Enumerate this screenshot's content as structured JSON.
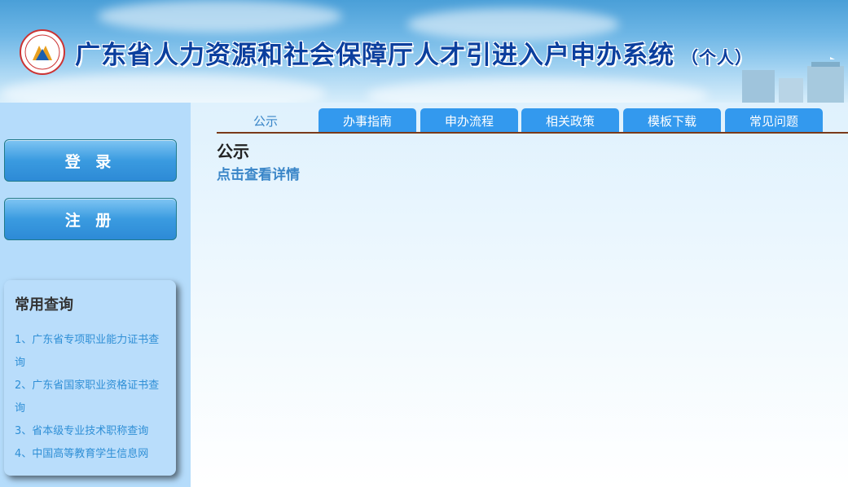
{
  "header": {
    "title": "广东省人力资源和社会保障厅人才引进入户申办系统",
    "subtitle": "（个人）",
    "logo_icon": "hrss-emblem-icon"
  },
  "sidebar": {
    "login_label": "登 录",
    "register_label": "注 册",
    "query": {
      "title": "常用查询",
      "items": [
        {
          "label": "1、广东省专项职业能力证书查询"
        },
        {
          "label": "2、广东省国家职业资格证书查询"
        },
        {
          "label": "3、省本级专业技术职称查询"
        },
        {
          "label": "4、中国高等教育学生信息网"
        }
      ]
    }
  },
  "main": {
    "tabs": [
      {
        "label": "公示"
      },
      {
        "label": "办事指南"
      },
      {
        "label": "申办流程"
      },
      {
        "label": "相关政策"
      },
      {
        "label": "模板下载"
      },
      {
        "label": "常见问题"
      }
    ],
    "active_tab": "公示",
    "content_title": "公示",
    "content_link": "点击查看详情"
  },
  "colors": {
    "tab_blue": "#3399ee",
    "link_blue": "#3a86c8",
    "title_blue": "#0b3f9e",
    "sidebar_bg": "#b5dcfb"
  }
}
